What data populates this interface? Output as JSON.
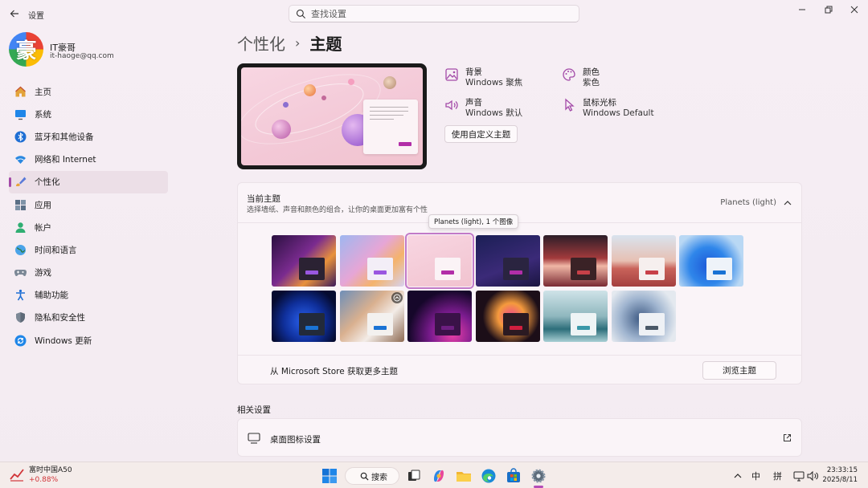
{
  "window": {
    "title": "设置",
    "search_placeholder": "查找设置"
  },
  "profile": {
    "avatar_char": "豪",
    "name": "IT豪哥",
    "email": "it-haoge@qq.com"
  },
  "nav": [
    {
      "label": "主页",
      "icon": "home-icon"
    },
    {
      "label": "系统",
      "icon": "monitor-icon"
    },
    {
      "label": "蓝牙和其他设备",
      "icon": "bluetooth-icon"
    },
    {
      "label": "网络和 Internet",
      "icon": "wifi-icon"
    },
    {
      "label": "个性化",
      "icon": "brush-icon",
      "active": true
    },
    {
      "label": "应用",
      "icon": "apps-icon"
    },
    {
      "label": "帐户",
      "icon": "person-icon"
    },
    {
      "label": "时间和语言",
      "icon": "globe-icon"
    },
    {
      "label": "游戏",
      "icon": "gamepad-icon"
    },
    {
      "label": "辅助功能",
      "icon": "accessibility-icon"
    },
    {
      "label": "隐私和安全性",
      "icon": "shield-icon"
    },
    {
      "label": "Windows 更新",
      "icon": "update-icon"
    }
  ],
  "breadcrumb": {
    "parent": "个性化",
    "separator": "›",
    "current": "主题"
  },
  "properties": {
    "background": {
      "title": "背景",
      "value": "Windows 聚焦"
    },
    "color": {
      "title": "颜色",
      "value": "紫色"
    },
    "sound": {
      "title": "声音",
      "value": "Windows 默认"
    },
    "cursor": {
      "title": "鼠标光标",
      "value": "Windows Default"
    },
    "custom_button": "使用自定义主题"
  },
  "current_theme": {
    "title": "当前主题",
    "description": "选择墙纸、声音和颜色的组合，让你的桌面更加富有个性",
    "value": "Planets (light)",
    "tooltip": "Planets (light), 1 个图像"
  },
  "themes": [
    {
      "bg": "linear-gradient(135deg,#2a1040,#7a2b8f 45%,#e8913b 70%,#3b1a5c)",
      "panel": "#2b2233",
      "accent": "#9a57e0"
    },
    {
      "bg": "linear-gradient(135deg,#9fb7f0,#e6a6d6 45%,#f4b36c 70%,#d7d2f0)",
      "panel": "#f3eef7",
      "accent": "#9a57e0"
    },
    {
      "bg": "linear-gradient(160deg,#f8d6e2,#f1c3cf)",
      "panel": "#fbf3f6",
      "accent": "#b22ea8",
      "selected": true
    },
    {
      "bg": "linear-gradient(160deg,#1b1f55,#3b2a78 60%,#1a1540)",
      "panel": "#2a2440",
      "accent": "#b22ea8"
    },
    {
      "bg": "linear-gradient(180deg,#2c1d28,#a33a3c 45%,#f0b7a6 60%,#7a2a33)",
      "panel": "#3a2226",
      "accent": "#c84048"
    },
    {
      "bg": "linear-gradient(180deg,#d9e3ee,#e7c0b3 50%,#c9635a 65%,#a43f3f)",
      "panel": "#f6efee",
      "accent": "#c84048"
    },
    {
      "bg": "radial-gradient(circle at 45% 60%,#1e5ad8,#2f86ea 40%,#b9d8f4 75%)",
      "panel": "#eef3f9",
      "accent": "#1a73d4"
    },
    {
      "bg": "radial-gradient(circle at 50% 60%,#2a62f0,#0f2f9a 45%,#050b30 80%)",
      "panel": "#222a3a",
      "accent": "#1a73d4"
    },
    {
      "bg": "linear-gradient(135deg,#6f8fb8,#d9b08f 40%,#f3ece7 65%,#8d6a52)",
      "panel": "#f3f1ef",
      "accent": "#1a73d4",
      "badge": true
    },
    {
      "bg": "radial-gradient(circle at 70% 85%,#e83fa7,#7a1b8e 35%,#16072a 70%)",
      "panel": "#3a1248",
      "accent": "#6d1f80"
    },
    {
      "bg": "radial-gradient(circle at 55% 50%,#f04b8a,#f59a3d 30%,#1c0e18 65%)",
      "panel": "#2b1a22",
      "accent": "#d11f3f"
    },
    {
      "bg": "linear-gradient(180deg,#cfe3e8,#8fb7be 50%,#2d6e7a 75%,#a9cfd4)",
      "panel": "#eef4f5",
      "accent": "#3a98a8"
    },
    {
      "bg": "radial-gradient(circle at 45% 55%,#3f5b84,#9fb4cf 45%,#e4e9ef 80%)",
      "panel": "#eef1f5",
      "accent": "#4a5968"
    }
  ],
  "store": {
    "label": "从 Microsoft Store 获取更多主题",
    "button": "浏览主题"
  },
  "related": {
    "title": "相关设置",
    "desktop_icons": "桌面图标设置"
  },
  "taskbar": {
    "stock_name": "富时中国A50",
    "stock_change": "+0.88%",
    "search": "搜索",
    "ime1": "中",
    "ime2": "拼",
    "time": "23:33:15",
    "date": "2025/8/11"
  },
  "colors": {
    "accent": "#a34aa8",
    "selected_outline": "#c27ac8"
  }
}
